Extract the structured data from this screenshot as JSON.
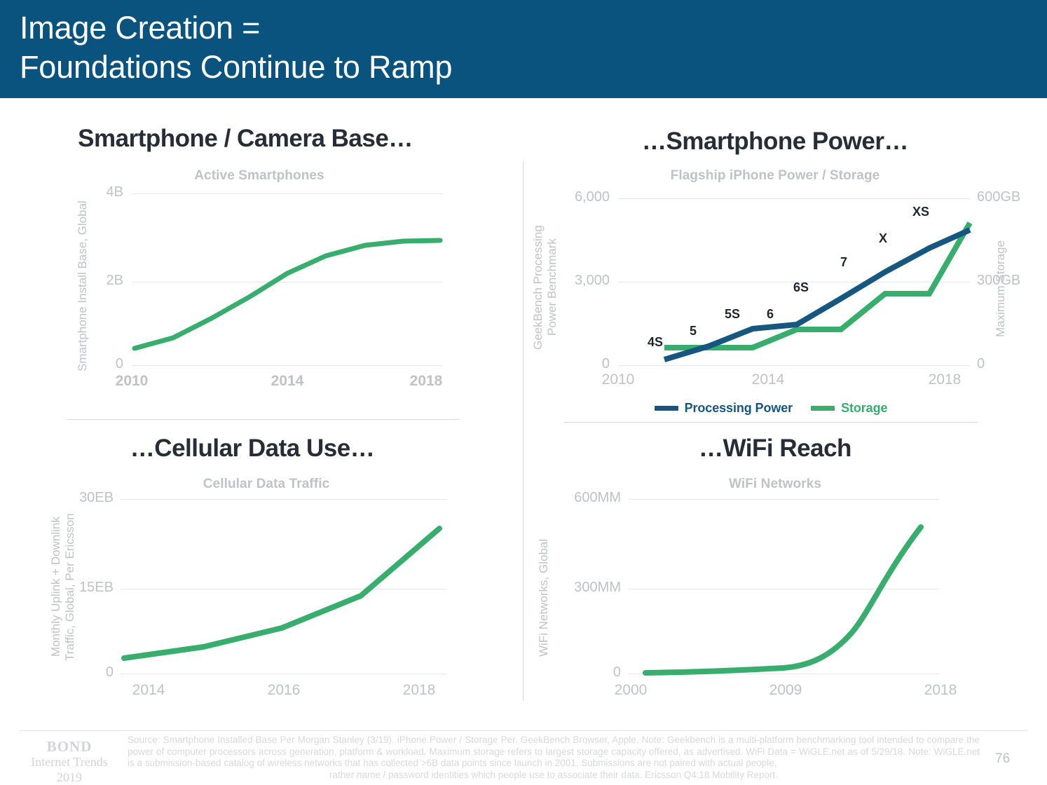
{
  "slide": {
    "title": "Image Creation =\nFoundations Continue to Ramp",
    "header_color": "#0b537f",
    "page_number": "76"
  },
  "colors": {
    "green": "#38ad6e",
    "blue": "#17567f",
    "title_text": "#262d37",
    "muted_gray": "#bfc2c6"
  },
  "footer": {
    "logo_name": "BOND",
    "logo_sub": "Internet Trends",
    "logo_year": "2019",
    "source_main": "Source: Smartphone Installed Base Per Morgan Stanley (3/19).  iPhone Power / Storage Per. GeekBench Browser, Apple. Note: Geekbench is a multi-platform benchmarking tool intended to compare the power of computer processors across generation, platform & workload.  Maximum storage refers to largest storage capacity offered, as advertised. WiFi Data =  WiGLE.net as of 5/29/18.  Note: WiGLE.net is a submission-based catalog of wireless networks that has collected >6B data points since launch in 2001. Submissions are not paired with actual people,",
    "source_last_line": "rather name / password identities which people use to associate their data.  Ericsson Q4:18 Mobility Report."
  },
  "quadrants": {
    "q1": {
      "heading": "Smartphone / Camera Base…"
    },
    "q2": {
      "heading": "…Smartphone Power…"
    },
    "q3": {
      "heading": "…Cellular Data Use…"
    },
    "q4": {
      "heading": "…WiFi Reach"
    }
  },
  "legend": {
    "items": [
      {
        "label": "Processing Power",
        "color": "#17567f"
      },
      {
        "label": "Storage",
        "color": "#38ad6e"
      }
    ]
  },
  "chart_data": [
    {
      "id": "active-smartphones",
      "type": "line",
      "title": "Active Smartphones",
      "xlabel": "",
      "ylabel": "Smartphone Install Base, Global",
      "yticks": [
        "0",
        "2B",
        "4B"
      ],
      "ytickvals": [
        0,
        2,
        4
      ],
      "ylim": [
        0,
        4
      ],
      "xticks": [
        "2010",
        "2014",
        "2018"
      ],
      "xtickvals": [
        2010,
        2014,
        2018
      ],
      "xlim": [
        2010,
        2018
      ],
      "grid": true,
      "legend_position": "none",
      "series": [
        {
          "name": "Active Smartphones",
          "color": "#38ad6e",
          "x": [
            2010,
            2011,
            2012,
            2013,
            2014,
            2015,
            2016,
            2017,
            2018
          ],
          "values": [
            0.38,
            0.62,
            1.05,
            1.55,
            2.05,
            2.5,
            2.8,
            2.92,
            2.95
          ]
        }
      ]
    },
    {
      "id": "flagship-iphone-power-storage",
      "type": "line",
      "title": "Flagship iPhone Power / Storage",
      "xlabel": "",
      "ylabel": "GeekBench Processing\nPower Benchmark",
      "ylabel_right": "Maximum Storage",
      "yticks": [
        "0",
        "3,000",
        "6,000"
      ],
      "ytickvals": [
        0,
        3000,
        6000
      ],
      "ylim": [
        0,
        6000
      ],
      "yticks_right": [
        "0",
        "300GB",
        "600GB"
      ],
      "ytickvals_right": [
        0,
        300,
        600
      ],
      "ylim_right": [
        0,
        600
      ],
      "xticks": [
        "2010",
        "2014",
        "2018"
      ],
      "xtickvals": [
        2010,
        2014,
        2018
      ],
      "xlim": [
        2010,
        2018
      ],
      "grid": true,
      "legend_position": "bottom",
      "point_labels": [
        "4S",
        "5",
        "5S",
        "6",
        "6S",
        "7",
        "X",
        "XS"
      ],
      "series": [
        {
          "name": "Processing Power",
          "color": "#17567f",
          "axis": "left",
          "x": [
            2011,
            2012,
            2013,
            2014,
            2015,
            2016,
            2017,
            2018
          ],
          "values": [
            210,
            690,
            1300,
            1450,
            2400,
            3350,
            4200,
            4880
          ]
        },
        {
          "name": "Storage",
          "color": "#38ad6e",
          "axis": "right",
          "x": [
            2011,
            2012,
            2013,
            2014,
            2015,
            2016,
            2017,
            2018
          ],
          "values": [
            64,
            64,
            64,
            128,
            128,
            256,
            256,
            512
          ]
        }
      ]
    },
    {
      "id": "cellular-data-traffic",
      "type": "line",
      "title": "Cellular Data Traffic",
      "xlabel": "",
      "ylabel": "Monthly Uplink + Downlink\nTraffic, Global, Per Ericsson",
      "yticks": [
        "0",
        "15EB",
        "30EB"
      ],
      "ytickvals": [
        0,
        15,
        30
      ],
      "ylim": [
        0,
        30
      ],
      "xticks": [
        "2014",
        "2016",
        "2018"
      ],
      "xtickvals": [
        2014,
        2016,
        2018
      ],
      "xlim": [
        2014,
        2018
      ],
      "grid": true,
      "legend_position": "none",
      "series": [
        {
          "name": "Cellular Data Traffic",
          "color": "#38ad6e",
          "x": [
            2014,
            2015,
            2016,
            2017,
            2018
          ],
          "values": [
            2.6,
            4.6,
            7.9,
            13.4,
            25.0
          ]
        }
      ]
    },
    {
      "id": "wifi-networks",
      "type": "line",
      "title": "WiFi Networks",
      "xlabel": "",
      "ylabel": "WiFi Networks, Global",
      "yticks": [
        "0",
        "300MM",
        "600MM"
      ],
      "ytickvals": [
        0,
        300,
        600
      ],
      "ylim": [
        0,
        600
      ],
      "xticks": [
        "2000",
        "2009",
        "2018"
      ],
      "xtickvals": [
        2000,
        2009,
        2018
      ],
      "xlim": [
        2000,
        2018
      ],
      "grid": true,
      "legend_position": "none",
      "series": [
        {
          "name": "WiFi Networks",
          "color": "#38ad6e",
          "x": [
            2001,
            2003,
            2005,
            2007,
            2009,
            2011,
            2013,
            2015,
            2016,
            2017,
            2018
          ],
          "values": [
            2,
            5,
            9,
            14,
            20,
            45,
            95,
            200,
            300,
            430,
            520
          ]
        }
      ]
    }
  ]
}
